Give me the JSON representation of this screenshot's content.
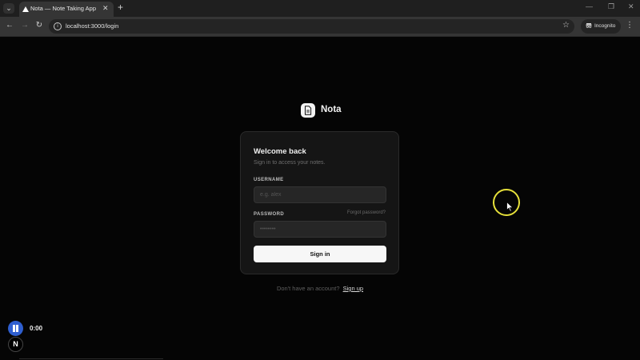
{
  "browser": {
    "tab_menu_icon": "chevron-down-icon",
    "tab": {
      "title": "Nota — Note Taking App",
      "close": "✕"
    },
    "new_tab": "+",
    "window_controls": {
      "minimize": "—",
      "restore": "❐",
      "close": "✕"
    },
    "nav": {
      "back": "←",
      "forward": "→",
      "reload": "↻"
    },
    "url": "localhost:3000/login",
    "bookmark": "☆",
    "incognito_label": "Incognito",
    "menu": "⋮"
  },
  "app": {
    "brand_name": "Nota"
  },
  "login": {
    "title": "Welcome back",
    "subtitle": "Sign in to access your notes.",
    "username_label": "USERNAME",
    "username_placeholder": "e.g. alex",
    "password_label": "PASSWORD",
    "password_placeholder": "••••••••",
    "forgot_password": "Forgot password?",
    "submit": "Sign in",
    "no_account_text": "Don't have an account?",
    "signup_link": "Sign up"
  },
  "recording": {
    "time": "0:00",
    "badge": "N"
  },
  "colors": {
    "page_background": "#050505",
    "card_background": "#151515",
    "button_background": "#f7f7f7",
    "cursor_highlight": "#e6e03a",
    "recorder_accent": "#2f5fd0"
  }
}
